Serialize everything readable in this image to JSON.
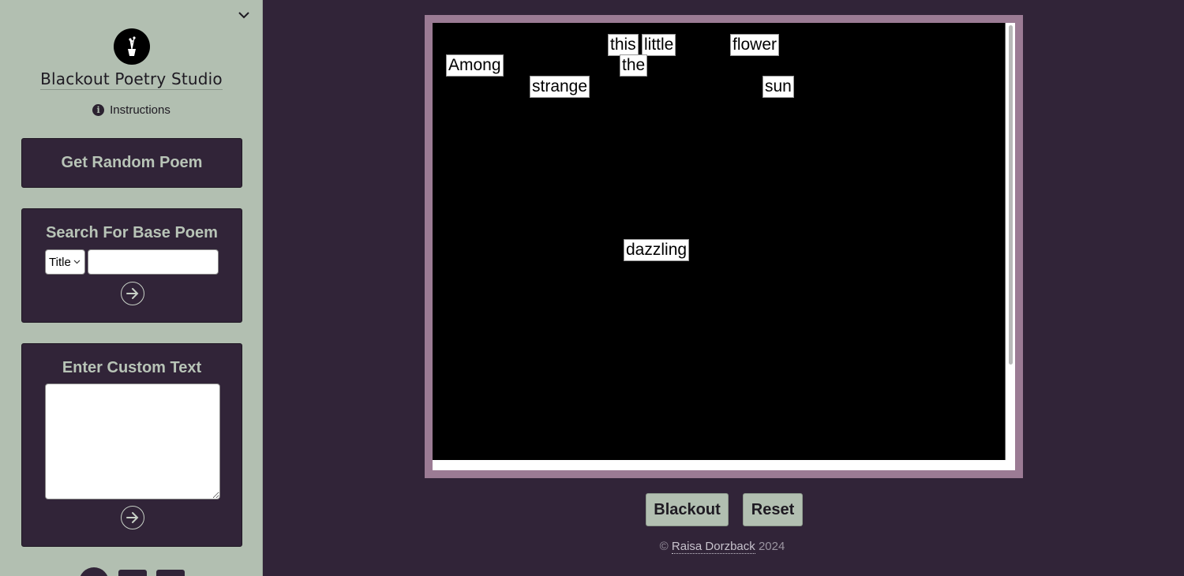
{
  "sidebar": {
    "app_title": "Blackout Poetry Studio",
    "instructions_label": "Instructions",
    "random_button_label": "Get Random Poem",
    "search": {
      "title": "Search For Base Poem",
      "select_value": "Title",
      "input_value": "",
      "input_placeholder": ""
    },
    "custom": {
      "title": "Enter Custom Text",
      "textarea_value": ""
    }
  },
  "board": {
    "words": [
      {
        "text": "this"
      },
      {
        "text": "little"
      },
      {
        "text": "flower"
      },
      {
        "text": "Among"
      },
      {
        "text": "the"
      },
      {
        "text": "strange"
      },
      {
        "text": "sun"
      },
      {
        "text": "dazzling"
      }
    ]
  },
  "actions": {
    "blackout_label": "Blackout",
    "reset_label": "Reset"
  },
  "footer": {
    "copyright_symbol": "©",
    "author": "Raisa Dorzback",
    "year": "2024"
  },
  "colors": {
    "background": "#312438",
    "sidebar": "#b2bfb1",
    "frame": "#9b7b94"
  }
}
